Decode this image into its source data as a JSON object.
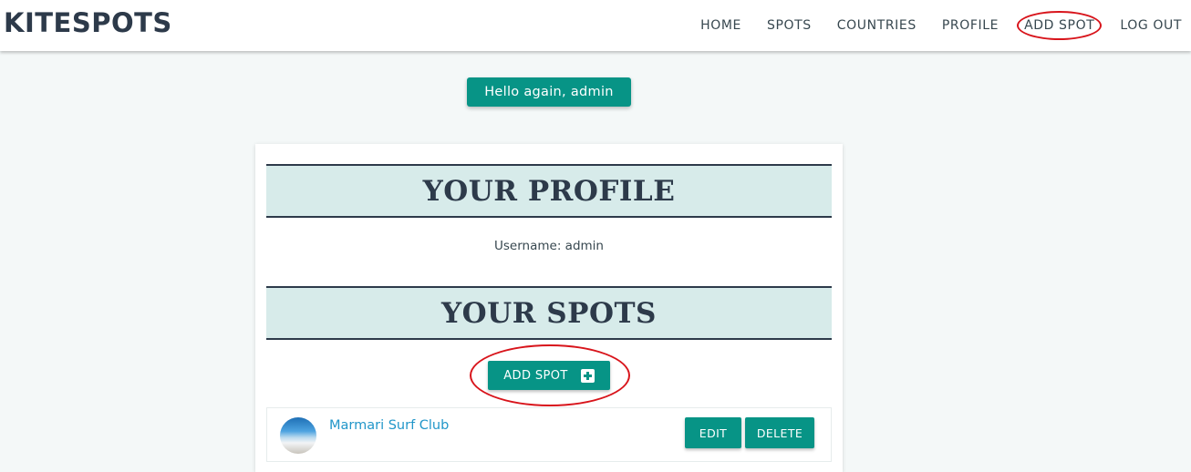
{
  "navbar": {
    "brand": "KITESPOTS",
    "links": [
      "HOME",
      "SPOTS",
      "COUNTRIES",
      "PROFILE",
      "ADD SPOT",
      "LOG OUT"
    ]
  },
  "greeting": "Hello again, admin",
  "profile": {
    "heading": "YOUR PROFILE",
    "username_text": "Username: admin"
  },
  "spots": {
    "heading": "YOUR SPOTS",
    "add_button_label": "ADD SPOT",
    "items": [
      {
        "title": "Marmari Surf Club",
        "edit_label": "EDIT",
        "delete_label": "DELETE"
      }
    ]
  },
  "colors": {
    "accent": "#079486",
    "header_bg": "#d7ebea",
    "dark_text": "#2d3a4a",
    "link": "#2196c9",
    "annotation": "#d8141b"
  }
}
